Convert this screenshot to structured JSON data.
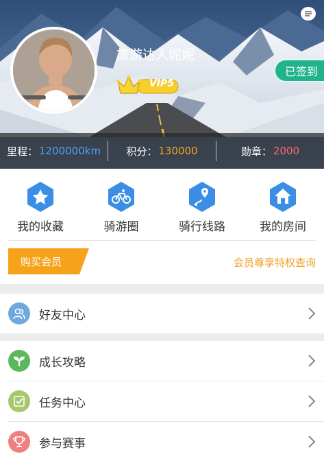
{
  "profile": {
    "username": "旅游达人妮妮",
    "vip_level": "VIP5",
    "checkin_label": "已签到"
  },
  "stats": {
    "mileage_label": "里程：",
    "mileage_value": "1200000km",
    "points_label": "积分：",
    "points_value": "130000",
    "medals_label": "勋章：",
    "medals_value": "2000"
  },
  "quick_nav": [
    {
      "label": "我的收藏",
      "icon": "star-icon"
    },
    {
      "label": "骑游圈",
      "icon": "bicycle-icon"
    },
    {
      "label": "骑行线路",
      "icon": "route-icon"
    },
    {
      "label": "我的房间",
      "icon": "home-icon"
    }
  ],
  "membership": {
    "buy_label": "购买会员",
    "privileges_link": "会员尊享特权查询"
  },
  "menu_group_1": [
    {
      "label": "好友中心",
      "icon": "friends-icon",
      "color": "#6fa8dc"
    }
  ],
  "menu_group_2": [
    {
      "label": "成长攻略",
      "icon": "sprout-icon",
      "color": "#5cb85c"
    },
    {
      "label": "任务中心",
      "icon": "task-check-icon",
      "color": "#a8c66c"
    },
    {
      "label": "参与赛事",
      "icon": "trophy-icon",
      "color": "#f08080"
    }
  ],
  "colors": {
    "accent_blue": "#3a8ee6",
    "mileage_blue": "#4da3ff",
    "points_orange": "#f5a623",
    "medals_red": "#ff6b6b",
    "checkin_green": "#21b38c",
    "member_orange": "#f7a21b"
  }
}
